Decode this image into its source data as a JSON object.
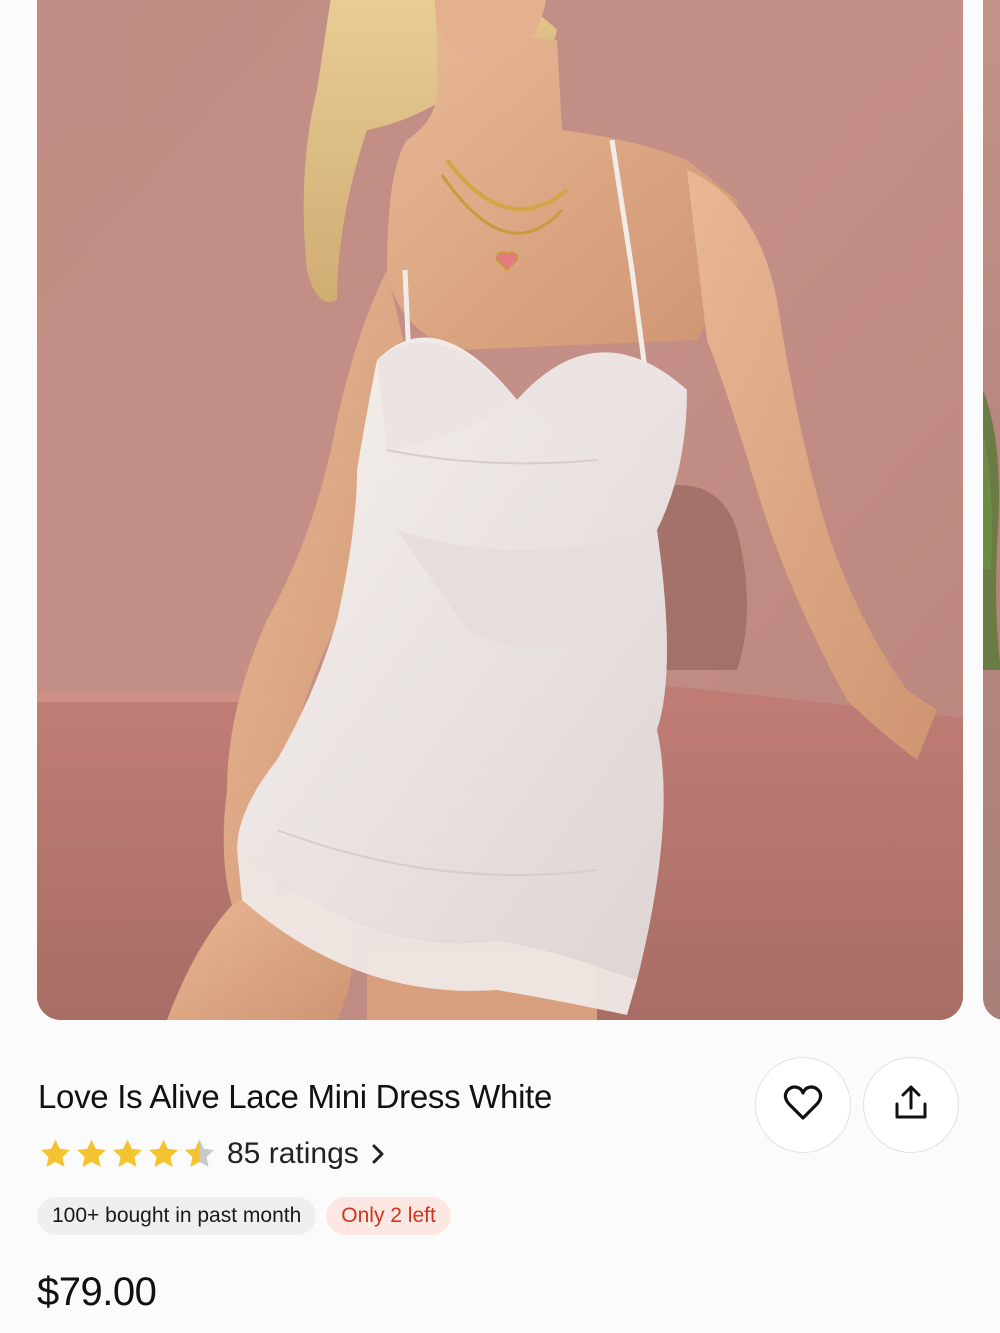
{
  "product": {
    "title": "Love Is Alive Lace Mini Dress White",
    "rating": {
      "stars": 4.5,
      "count_label": "85 ratings",
      "star_color": "#f4c430",
      "empty_star_color": "#c8c8c8"
    },
    "badges": {
      "bought": "100+ bought in past month",
      "stock": "Only 2 left"
    },
    "price": "$79.00"
  },
  "actions": {
    "favorite_icon": "heart-icon",
    "share_icon": "share-icon"
  },
  "colors": {
    "stock_text": "#d2331c",
    "stock_bg": "#fde7e2",
    "badge_bg": "#efefef"
  }
}
